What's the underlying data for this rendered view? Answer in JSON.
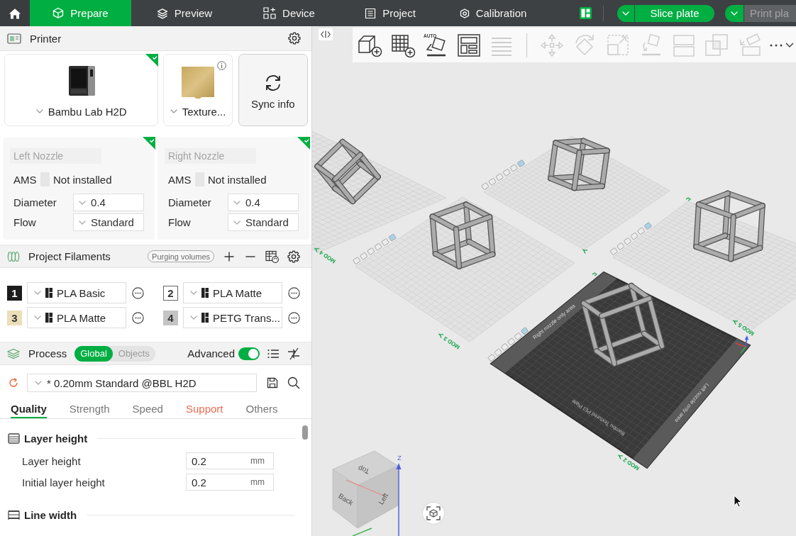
{
  "topbar": {
    "tabs": [
      {
        "label": "Prepare",
        "selected": true
      },
      {
        "label": "Preview",
        "selected": false
      },
      {
        "label": "Device",
        "selected": false
      },
      {
        "label": "Project",
        "selected": false
      },
      {
        "label": "Calibration",
        "selected": false
      }
    ],
    "slice_button": {
      "label": "Slice plate",
      "disabled": false
    },
    "print_button": {
      "label": "Print pla",
      "disabled": true
    }
  },
  "printer": {
    "title": "Printer",
    "model": "Bambu Lab H2D",
    "synced": true,
    "plate": "Texture...",
    "sync_button": "Sync info",
    "nozzles": [
      {
        "title": "Left Nozzle",
        "synced": true,
        "ams_label": "AMS",
        "ams_status": "Not installed",
        "diameter_label": "Diameter",
        "diameter": "0.4",
        "flow_label": "Flow",
        "flow": "Standard"
      },
      {
        "title": "Right Nozzle",
        "synced": true,
        "ams_label": "AMS",
        "ams_status": "Not installed",
        "diameter_label": "Diameter",
        "diameter": "0.4",
        "flow_label": "Flow",
        "flow": "Standard"
      }
    ]
  },
  "filaments": {
    "title": "Project Filaments",
    "purge_button": "Purging volumes",
    "items": [
      {
        "number": "1",
        "color": "#1c1c1c",
        "name": "PLA Basic"
      },
      {
        "number": "2",
        "color": "#ffffff",
        "name": "PLA Matte"
      },
      {
        "number": "3",
        "color": "#eadfb8",
        "name": "PLA Matte"
      },
      {
        "number": "4",
        "color": "#c4c4c4",
        "name": "PETG Trans..."
      }
    ]
  },
  "process": {
    "title": "Process",
    "scopes": [
      {
        "label": "Global",
        "selected": true
      },
      {
        "label": "Objects",
        "selected": false
      }
    ],
    "advanced_label": "Advanced",
    "advanced": true,
    "preset": {
      "name": "* 0.20mm Standard @BBL H2D",
      "modified": true
    },
    "tabs": [
      {
        "label": "Quality",
        "selected": true,
        "modified": false
      },
      {
        "label": "Strength",
        "selected": false,
        "modified": false
      },
      {
        "label": "Speed",
        "selected": false,
        "modified": false
      },
      {
        "label": "Support",
        "selected": false,
        "modified": true
      },
      {
        "label": "Others",
        "selected": false,
        "modified": false
      }
    ],
    "groups": [
      {
        "title": "Layer height",
        "rows": [
          {
            "label": "Layer height",
            "value": "0.2",
            "unit": "mm"
          },
          {
            "label": "Initial layer height",
            "value": "0.2",
            "unit": "mm"
          }
        ]
      },
      {
        "title": "Line width"
      }
    ]
  },
  "viewport": {
    "toolbar": {
      "groups": [
        {
          "items": [
            {
              "kind": "add-cube",
              "disabled": false
            },
            {
              "kind": "add-plate",
              "disabled": false
            },
            {
              "kind": "auto-orient",
              "label": "AUTO",
              "disabled": false
            },
            {
              "kind": "arrange",
              "disabled": false
            },
            {
              "kind": "layers",
              "disabled": true
            }
          ]
        },
        {
          "items": [
            {
              "kind": "move",
              "disabled": true
            },
            {
              "kind": "rotate",
              "disabled": true
            },
            {
              "kind": "scale",
              "disabled": true
            },
            {
              "kind": "lay-on-face",
              "disabled": true
            },
            {
              "kind": "split",
              "disabled": true
            },
            {
              "kind": "boolean",
              "disabled": true
            },
            {
              "kind": "cut",
              "disabled": true
            }
          ]
        }
      ]
    },
    "plates": [
      {
        "label": "MOD 4",
        "active": false,
        "has_model": true
      },
      {
        "active": false,
        "has_model": true
      },
      {
        "label": "MOD 3",
        "active": false,
        "has_model": true
      },
      {
        "label": "MOD 5",
        "active": false,
        "has_model": true
      },
      {
        "label": "MOD 2",
        "active": true,
        "has_model": true,
        "right_area": "Right nozzle only area",
        "bed_name": "Bambu Textured PEI Plate",
        "left_area": "Left nozzle only area"
      }
    ],
    "view_cube": {
      "top": "Top",
      "back": "Back",
      "left": "Left",
      "z_axis": "Z"
    }
  }
}
